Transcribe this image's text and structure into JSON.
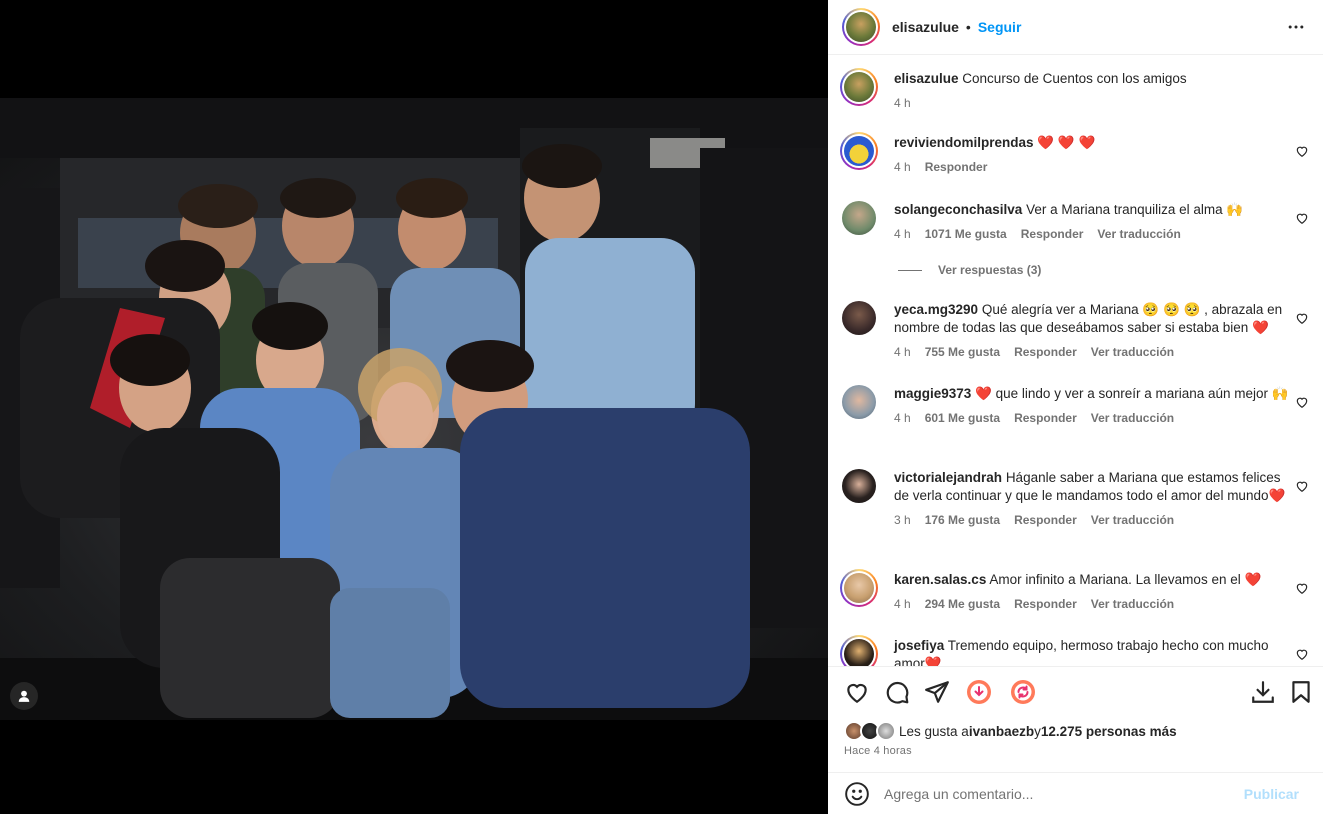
{
  "header": {
    "username": "elisazulue",
    "separator": "•",
    "follow_label": "Seguir"
  },
  "caption": {
    "username": "elisazulue",
    "text": "Concurso de Cuentos con los amigos",
    "time": "4 h"
  },
  "comments": [
    {
      "username": "reviviendomilprendas",
      "text": "",
      "hearts": "❤️ ❤️ ❤️",
      "time": "4 h",
      "likes": "",
      "reply": "Responder",
      "translate": ""
    },
    {
      "username": "solangeconchasilva",
      "text": "Ver a Mariana tranquiliza el alma 🙌",
      "time": "4 h",
      "likes": "1071 Me gusta",
      "reply": "Responder",
      "translate": "Ver traducción"
    },
    {
      "username": "yeca.mg3290",
      "text": "Qué alegría ver a Mariana 🥺 🥺 🥺 , abrazala en nombre de todas las que deseábamos saber si estaba bien",
      "heart": "❤️",
      "time": "4 h",
      "likes": "755 Me gusta",
      "reply": "Responder",
      "translate": "Ver traducción"
    },
    {
      "username": "maggie9373",
      "text": " que lindo y ver a sonreír a mariana aún mejor 🙌",
      "heart": "❤️",
      "time": "4 h",
      "likes": "601 Me gusta",
      "reply": "Responder",
      "translate": "Ver traducción"
    },
    {
      "username": "victorialejandrah",
      "text": "Háganle saber a Mariana que estamos felices de verla continuar y que le mandamos todo el amor del mundo",
      "heart": "❤️",
      "time": "3 h",
      "likes": "176 Me gusta",
      "reply": "Responder",
      "translate": "Ver traducción"
    },
    {
      "username": "karen.salas.cs",
      "text": "Amor infinito a Mariana. La llevamos en el",
      "heart": "❤️",
      "time": "4 h",
      "likes": "294 Me gusta",
      "reply": "Responder",
      "translate": "Ver traducción"
    },
    {
      "username": "josefiya",
      "text": "Tremendo equipo, hermoso trabajo hecho con mucho amor",
      "heart": "❤️",
      "time": "",
      "likes": "",
      "reply": "",
      "translate": ""
    }
  ],
  "view_replies": "Ver respuestas (3)",
  "likes": {
    "prefix": "Les gusta a ",
    "user": "ivanbaezb",
    "middle": " y ",
    "others": "12.275 personas más"
  },
  "posted_ago": "Hace 4 horas",
  "composer": {
    "placeholder": "Agrega un comentario...",
    "publish_label": "Publicar"
  },
  "icons": {
    "like": "heart-icon",
    "comment": "comment-icon",
    "share": "send-icon",
    "save": "bookmark-icon",
    "download": "download-icon",
    "emoji": "smiley-icon",
    "more": "more-options-icon",
    "tag": "user-tag-icon"
  },
  "colors": {
    "accent": "#0095f6",
    "publish_disabled": "#b2dffc",
    "heart_red": "#ed4956",
    "muted_text": "#737373",
    "divider": "#efefef"
  }
}
